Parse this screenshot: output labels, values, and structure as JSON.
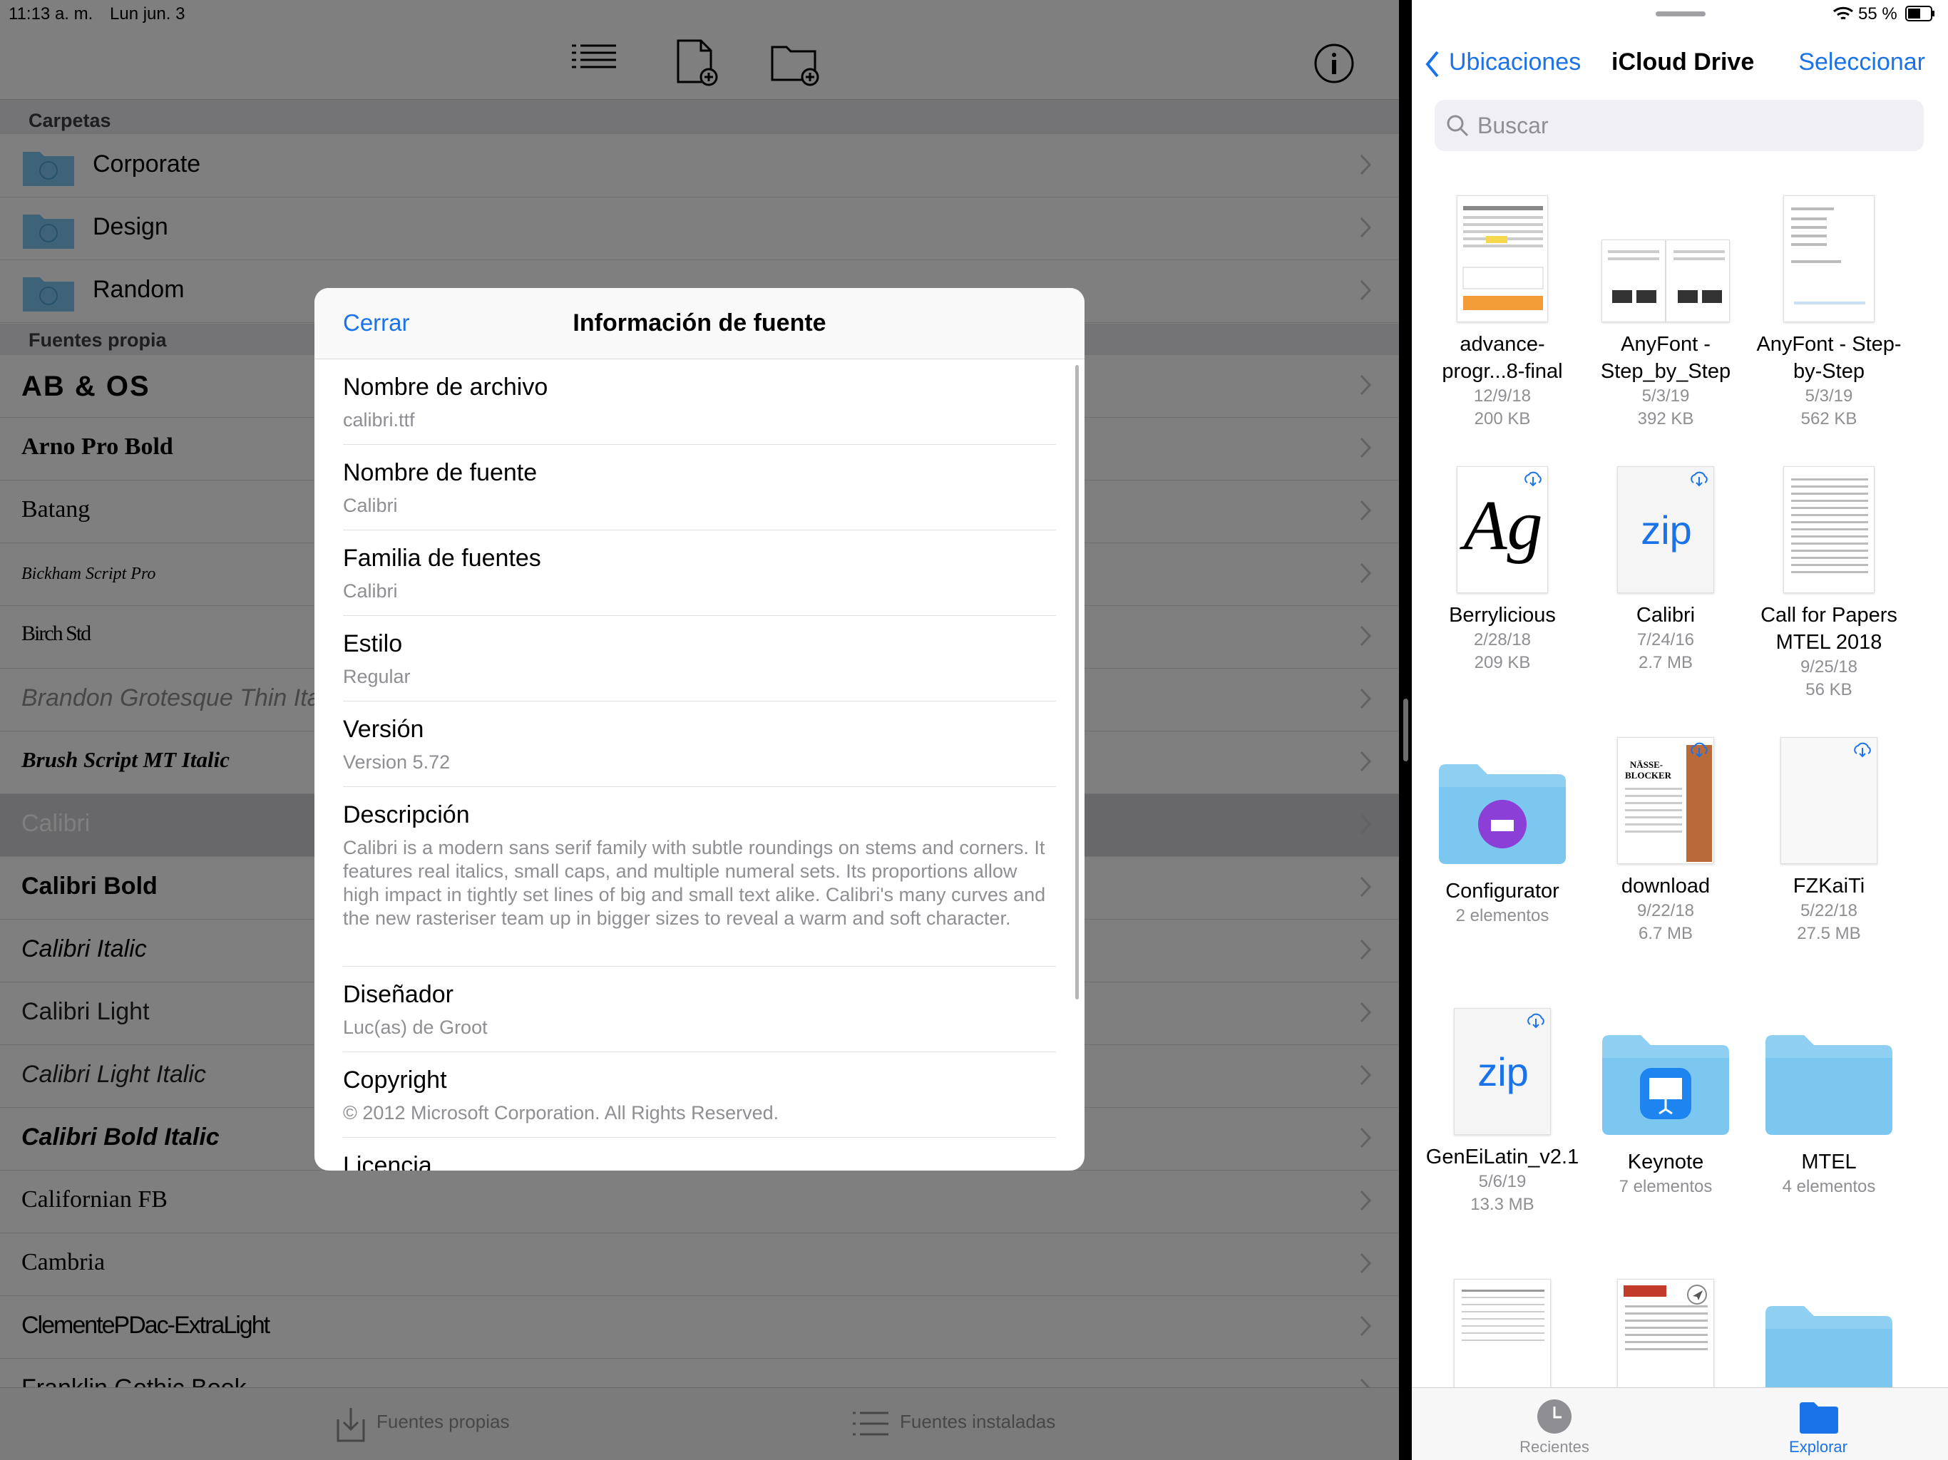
{
  "status": {
    "time": "11:13 a. m.",
    "date": "Lun jun. 3",
    "battery": "55 %"
  },
  "left": {
    "sections": {
      "folders": "Carpetas",
      "own_fonts": "Fuentes propia"
    },
    "folders": [
      {
        "label": "Corporate"
      },
      {
        "label": "Design"
      },
      {
        "label": "Random"
      }
    ],
    "fonts": [
      {
        "label": "AB & OS"
      },
      {
        "label": "Arno Pro Bold"
      },
      {
        "label": "Batang"
      },
      {
        "label": "Bickham Script Pro"
      },
      {
        "label": "Birch Std"
      },
      {
        "label": "Brandon Grotesque Thin Italic"
      },
      {
        "label": "Brush Script MT Italic"
      },
      {
        "label": "Calibri"
      },
      {
        "label": "Calibri Bold"
      },
      {
        "label": "Calibri Italic"
      },
      {
        "label": "Calibri Light"
      },
      {
        "label": "Calibri Light Italic"
      },
      {
        "label": "Calibri Bold Italic"
      },
      {
        "label": "Californian FB"
      },
      {
        "label": "Cambria"
      },
      {
        "label": "ClementePDac-ExtraLight"
      },
      {
        "label": "Franklin Gothic Book"
      }
    ],
    "bottom": {
      "own": "Fuentes propias",
      "installed": "Fuentes instaladas"
    }
  },
  "modal": {
    "close": "Cerrar",
    "title": "Información de fuente",
    "fields": [
      {
        "key": "Nombre de archivo",
        "value": "calibri.ttf"
      },
      {
        "key": "Nombre de fuente",
        "value": "Calibri"
      },
      {
        "key": "Familia de fuentes",
        "value": "Calibri"
      },
      {
        "key": "Estilo",
        "value": "Regular"
      },
      {
        "key": "Versión",
        "value": "Version 5.72"
      },
      {
        "key": "Descripción",
        "value": "Calibri is a modern sans serif family with subtle roundings on stems and corners. It features real italics, small caps, and multiple numeral sets. Its proportions allow high impact in tightly set lines of big and small text alike. Calibri's many curves and the new rasteriser team up in bigger sizes to reveal a warm and soft character."
      },
      {
        "key": "Diseñador",
        "value": "Luc(as) de Groot"
      },
      {
        "key": "Copyright",
        "value": "© 2012 Microsoft Corporation. All Rights Reserved."
      },
      {
        "key": "Licencia",
        "value": ""
      }
    ]
  },
  "right": {
    "back": "Ubicaciones",
    "title": "iCloud Drive",
    "select": "Seleccionar",
    "search_placeholder": "Buscar",
    "items": [
      {
        "name": "advance-progr...8-final",
        "line1": "12/9/18",
        "line2": "200 KB"
      },
      {
        "name": "AnyFont - Step_by_Step",
        "line1": "5/3/19",
        "line2": "392 KB"
      },
      {
        "name": "AnyFont - Step-by-Step",
        "line1": "5/3/19",
        "line2": "562 KB"
      },
      {
        "name": "Berrylicious",
        "line1": "2/28/18",
        "line2": "209 KB",
        "thumb_text": "Ag"
      },
      {
        "name": "Calibri",
        "line1": "7/24/16",
        "line2": "2.7 MB",
        "thumb_text": "zip"
      },
      {
        "name": "Call for Papers MTEL 2018",
        "line1": "9/25/18",
        "line2": "56 KB"
      },
      {
        "name": "Configurator",
        "line1": "2 elementos",
        "line2": ""
      },
      {
        "name": "download",
        "line1": "9/22/18",
        "line2": "6.7 MB",
        "thumb_text": "NÄSSE-BLOCKER"
      },
      {
        "name": "FZKaiTi",
        "line1": "5/22/18",
        "line2": "27.5 MB"
      },
      {
        "name": "GenEiLatin_v2.1",
        "line1": "5/6/19",
        "line2": "13.3 MB",
        "thumb_text": "zip"
      },
      {
        "name": "Keynote",
        "line1": "7 elementos",
        "line2": ""
      },
      {
        "name": "MTEL",
        "line1": "4 elementos",
        "line2": ""
      }
    ],
    "tabs": {
      "recents": "Recientes",
      "browse": "Explorar"
    }
  },
  "colors": {
    "accent": "#1a73e8",
    "folder": "#7cc7f0"
  }
}
